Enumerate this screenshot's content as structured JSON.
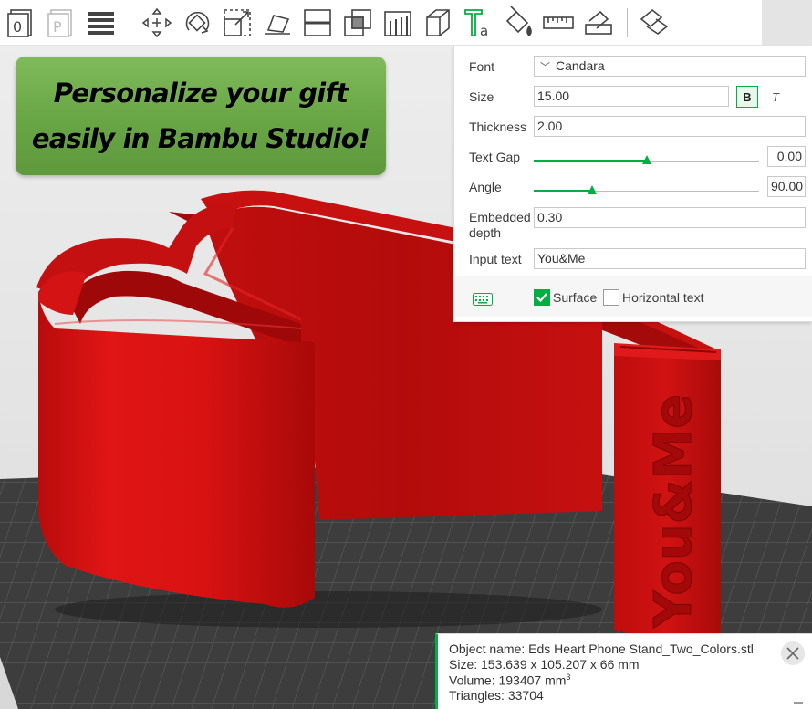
{
  "toolbar": {
    "tools": [
      {
        "icon": "add-plate-icon"
      },
      {
        "icon": "orient-plate-icon"
      },
      {
        "icon": "arrange-icon"
      },
      {
        "icon": "move-icon"
      },
      {
        "icon": "rotate-icon"
      },
      {
        "icon": "scale-icon"
      },
      {
        "icon": "lay-on-face-icon"
      },
      {
        "icon": "cut-icon"
      },
      {
        "icon": "boolean-icon"
      },
      {
        "icon": "support-paint-icon"
      },
      {
        "icon": "seam-paint-icon"
      },
      {
        "icon": "text-tool-icon"
      },
      {
        "icon": "color-paint-icon"
      },
      {
        "icon": "measure-icon"
      },
      {
        "icon": "assembly-icon"
      },
      {
        "icon": "split-parts-icon"
      }
    ]
  },
  "promo": {
    "line1": "Personalize your gift",
    "line2": "easily in Bambu Studio!"
  },
  "text_panel": {
    "font_label": "Font",
    "font_value": "Candara",
    "size_label": "Size",
    "size_value": "15.00",
    "bold_label": "B",
    "italic_label": "T",
    "thickness_label": "Thickness",
    "thickness_value": "2.00",
    "text_gap_label": "Text Gap",
    "text_gap_value": "0.00",
    "text_gap_slider_fraction": 0.5,
    "angle_label": "Angle",
    "angle_value": "90.00",
    "angle_slider_fraction": 0.26,
    "embedded_label_1": "Embedded",
    "embedded_label_2": "depth",
    "embedded_value": "0.30",
    "input_text_label": "Input text",
    "input_text_value": "You&Me",
    "surface_label": "Surface",
    "surface_checked": true,
    "horizontal_label": "Horizontal text",
    "horizontal_checked": false
  },
  "model": {
    "embossed_text": "You&Me",
    "color": "#d01010"
  },
  "object_info": {
    "name_line": "Object name: Eds Heart Phone Stand_Two_Colors.stl",
    "size_line": "Size: 153.639 x 105.207 x 66 mm",
    "volume_prefix": "Volume: 193407 mm",
    "volume_sup": "3",
    "triangles_line": "Triangles: 33704"
  },
  "colors": {
    "accent": "#00ae42",
    "model_red": "#d01010",
    "bed_dark": "#3a3a3a",
    "promo_green": "#6aa845"
  }
}
